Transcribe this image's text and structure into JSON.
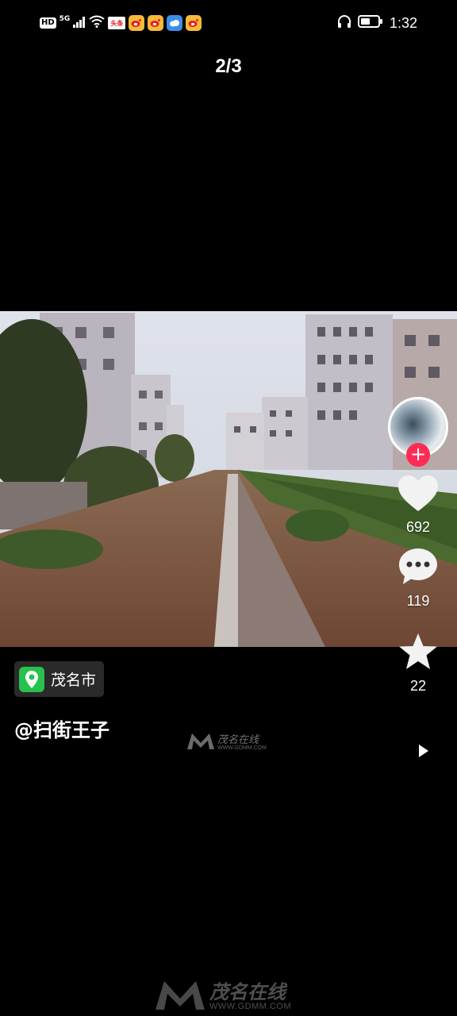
{
  "status_bar": {
    "network_badge": "HD",
    "network_type": "5G",
    "news_app_label": "头条",
    "time": "1:32"
  },
  "pager": {
    "current": "2/3"
  },
  "actions": {
    "like_count": "692",
    "comment_count": "119",
    "favorite_count": "22"
  },
  "post": {
    "location": "茂名市",
    "author": "@扫街王子"
  },
  "watermark": {
    "brand_cn": "茂名在线",
    "brand_url": "WWW.GDMM.COM"
  },
  "colors": {
    "background": "#000000",
    "follow_accent": "#fe2c55",
    "location_pin": "#27c24c"
  }
}
